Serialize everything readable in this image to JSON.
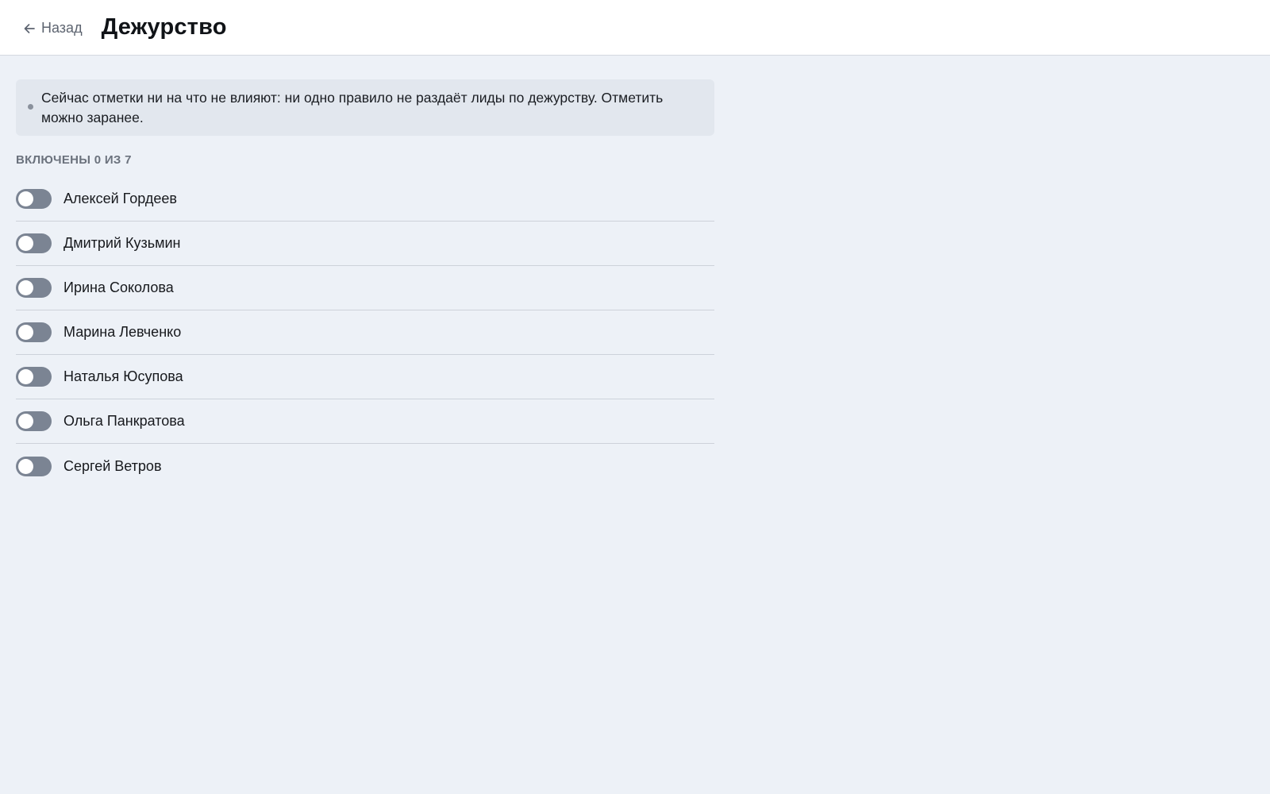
{
  "header": {
    "back_label": "Назад",
    "title": "Дежурство"
  },
  "notice": {
    "text": "Сейчас отметки ни на что не влияют: ни одно правило не раздаёт лиды по дежурству. Отметить можно заранее."
  },
  "counter": {
    "label": "ВКЛЮЧЕНЫ 0 ИЗ 7"
  },
  "people": [
    {
      "name": "Алексей Гордеев",
      "on": false
    },
    {
      "name": "Дмитрий Кузьмин",
      "on": false
    },
    {
      "name": "Ирина Соколова",
      "on": false
    },
    {
      "name": "Марина Левченко",
      "on": false
    },
    {
      "name": "Наталья Юсупова",
      "on": false
    },
    {
      "name": "Ольга Панкратова",
      "on": false
    },
    {
      "name": "Сергей Ветров",
      "on": false
    }
  ],
  "colors": {
    "page_bg": "#edf1f7",
    "toggle_off": "#7b8493",
    "notice_bg": "#e2e7ee"
  }
}
